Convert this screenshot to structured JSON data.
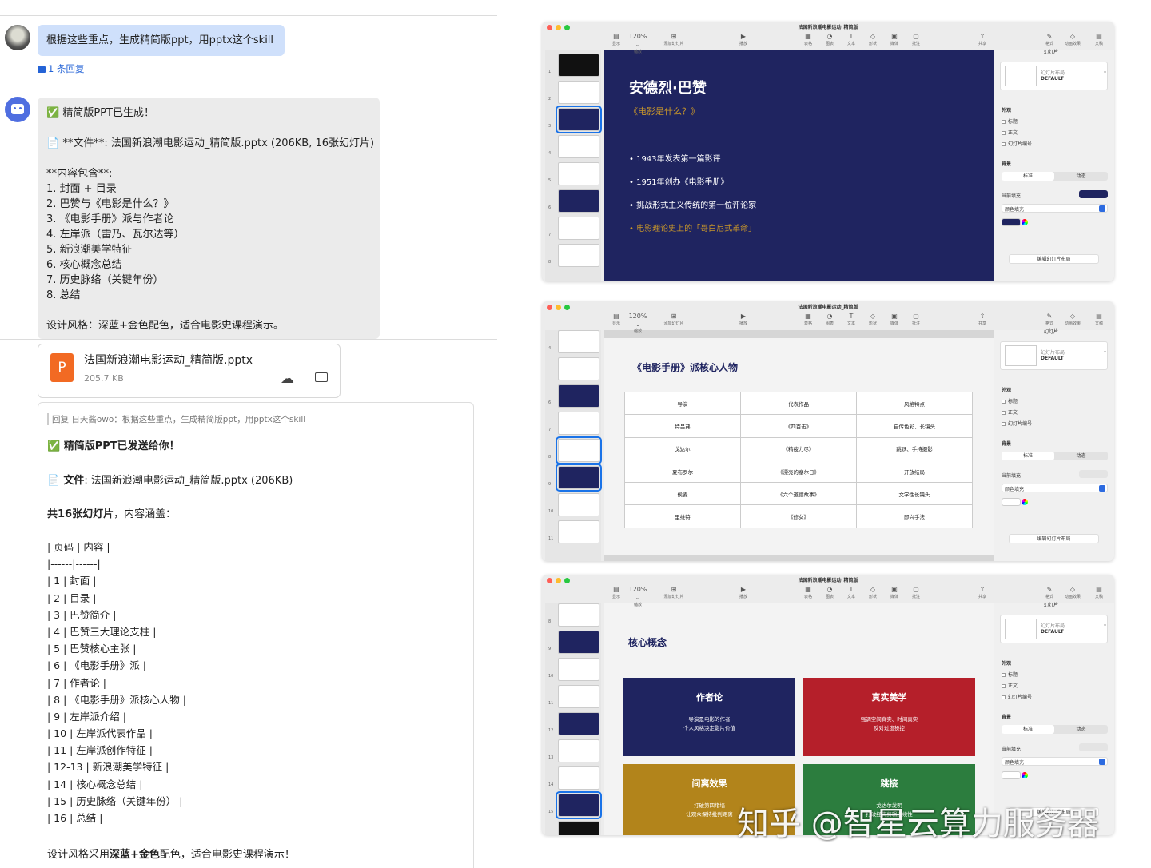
{
  "user_msg": {
    "text": "根据这些重点，生成精简版ppt，用pptx这个skill",
    "reply_count": "1 条回复"
  },
  "bot_msg": {
    "lines": [
      "✅ 精简版PPT已生成！",
      "",
      "📄 **文件**: 法国新浪潮电影运动_精简版.pptx (206KB, 16张幻灯片)",
      "",
      "**内容包含**:",
      "1. 封面 + 目录",
      "2. 巴赞与《电影是什么？》",
      "3. 《电影手册》派与作者论",
      "4. 左岸派（雷乃、瓦尔达等）",
      "5. 新浪潮美学特征",
      "6. 核心概念总结",
      "7. 历史脉络（关键年份）",
      "8. 总结",
      "",
      "设计风格：深蓝+金色配色，适合电影史课程演示。"
    ]
  },
  "file_card": {
    "icon": "P",
    "name": "法国新浪潮电影运动_精简版.pptx",
    "size": "205.7 KB"
  },
  "reply_card": {
    "quote": "回复 日天酱owo：根据这些重点，生成精简版ppt，用pptx这个skill",
    "title": "✅ 精简版PPT已发送给你！",
    "file_prefix": "📄 ",
    "file_label": "文件",
    "file_text": ": 法国新浪潮电影运动_精简版.pptx (206KB)",
    "count_title": "共16张幻灯片",
    "count_rest": "，内容涵盖：",
    "table_lines": [
      "| 页码 | 内容 |",
      "|------|------|",
      "| 1 | 封面 |",
      "| 2 | 目录 |",
      "| 3 | 巴赞简介 |",
      "| 4 | 巴赞三大理论支柱 |",
      "| 5 | 巴赞核心主张 |",
      "| 6 | 《电影手册》派 |",
      "| 7 | 作者论 |",
      "| 8 | 《电影手册》派核心人物 |",
      "| 9 | 左岸派介绍 |",
      "| 10 | 左岸派代表作品 |",
      "| 11 | 左岸派创作特征 |",
      "| 12-13 | 新浪潮美学特征 |",
      "| 14 | 核心概念总结 |",
      "| 15 | 历史脉络（关键年份） |",
      "| 16 | 总结 |"
    ],
    "footer_a": "设计风格采用",
    "footer_b": "深蓝+金色",
    "footer_c": "配色，适合电影史课程演示！"
  },
  "app": {
    "title": "法国新浪潮电影运动_精简版",
    "zoom": "120%",
    "toolbar": [
      {
        "icon": "▤",
        "label": "显示"
      },
      {
        "icon": "120% ⌄",
        "label": "缩放"
      },
      {
        "icon": "⊞",
        "label": "添加幻灯片"
      },
      {
        "icon": "▶",
        "label": "播放"
      },
      {
        "icon": "▦",
        "label": "表格"
      },
      {
        "icon": "◔",
        "label": "图表"
      },
      {
        "icon": "T",
        "label": "文本"
      },
      {
        "icon": "◇",
        "label": "形状"
      },
      {
        "icon": "▣",
        "label": "媒体"
      },
      {
        "icon": "▢",
        "label": "批注"
      },
      {
        "icon": "⇧",
        "label": "共享"
      },
      {
        "icon": "✎",
        "label": "格式"
      },
      {
        "icon": "◇",
        "label": "动画效果"
      },
      {
        "icon": "▤",
        "label": "文稿"
      }
    ],
    "inspector": {
      "header": "幻灯片",
      "layout_label": "幻灯片布局",
      "layout_value": "DEFAULT",
      "appearance": "外观",
      "opt_title": "标题",
      "opt_body": "正文",
      "opt_num": "幻灯片编号",
      "background": "背景",
      "seg_std": "标准",
      "seg_dyn": "动态",
      "current_fill": "当前填充",
      "fill_type": "颜色填充",
      "edit_btn": "编辑幻灯片布局"
    }
  },
  "slide1": {
    "title": "安德烈·巴赞",
    "subtitle": "《电影是什么？》",
    "bullets": [
      "• 1943年发表第一篇影评",
      "• 1951年创办《电影手册》",
      "• 挑战形式主义传统的第一位评论家"
    ],
    "highlight": "• 电影理论史上的「哥白尼式革命」",
    "thumb_nums": [
      "1",
      "2",
      "3",
      "4",
      "5",
      "6",
      "7",
      "8"
    ]
  },
  "slide2": {
    "title": "《电影手册》派核心人物",
    "headers": [
      "导演",
      "代表作品",
      "风格特点"
    ],
    "rows": [
      [
        "特吕弗",
        "《四百击》",
        "自传色彩、长镜头"
      ],
      [
        "戈达尔",
        "《精疲力尽》",
        "跳跃、手持摄影"
      ],
      [
        "夏布罗尔",
        "《漂亮的塞尔日》",
        "开放结局"
      ],
      [
        "侯麦",
        "《六个道德故事》",
        "文学性长镜头"
      ],
      [
        "里维特",
        "《修女》",
        "即兴手法"
      ]
    ],
    "thumb_nums": [
      "4",
      "",
      "6",
      "7",
      "8",
      "9",
      "10",
      "11"
    ]
  },
  "slide3": {
    "title": "核心概念",
    "cards": [
      {
        "title": "作者论",
        "body": "导演是电影的作者\n个人风格决定影片价值"
      },
      {
        "title": "真实美学",
        "body": "强调空间真实、时间真实\n反对过度操控"
      },
      {
        "title": "间离效果",
        "body": "打破第四堵墙\n让观众保持批判距离"
      },
      {
        "title": "跳接",
        "body": "戈达尔发明\n打破经典剪辑连续性"
      }
    ],
    "thumb_nums": [
      "8",
      "9",
      "10",
      "11",
      "12",
      "13",
      "14",
      "15",
      "16"
    ]
  },
  "colors": {
    "navy": "#1f2460",
    "gold": "#c8962a",
    "red": "#b51f2a",
    "mustard": "#b2841b",
    "green": "#2c7d3e",
    "bubble": "#cfe0fb"
  },
  "watermark": "知乎 @智星云算力服务器"
}
